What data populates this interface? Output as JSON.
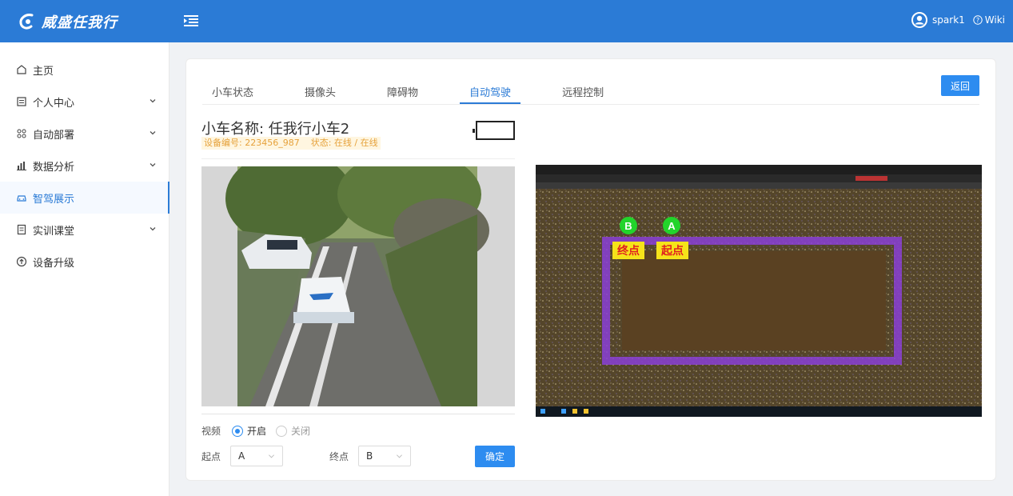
{
  "app": {
    "title": "威盛任我行",
    "user": "spark1",
    "wiki": "Wiki",
    "brand_color": "#2b7bd6"
  },
  "sidebar": {
    "items": [
      {
        "label": "主页",
        "icon": "home-icon",
        "expandable": false,
        "active": false
      },
      {
        "label": "个人中心",
        "icon": "profile-icon",
        "expandable": true,
        "active": false
      },
      {
        "label": "自动部署",
        "icon": "grid-icon",
        "expandable": true,
        "active": false
      },
      {
        "label": "数据分析",
        "icon": "bar-chart-icon",
        "expandable": true,
        "active": false
      },
      {
        "label": "智驾展示",
        "icon": "car-icon",
        "expandable": false,
        "active": true
      },
      {
        "label": "实训课堂",
        "icon": "book-icon",
        "expandable": true,
        "active": false
      },
      {
        "label": "设备升级",
        "icon": "upgrade-icon",
        "expandable": false,
        "active": false
      }
    ]
  },
  "tabs": [
    {
      "label": "小车状态",
      "active": false
    },
    {
      "label": "摄像头",
      "active": false
    },
    {
      "label": "障碍物",
      "active": false
    },
    {
      "label": "自动驾驶",
      "active": true
    },
    {
      "label": "远程控制",
      "active": false
    }
  ],
  "back_button": "返回",
  "car": {
    "name": "小车名称: 任我行小车2",
    "device_id": "设备编号: 223456_987",
    "status": "状态: 在线 / 在线",
    "battery_level": 0
  },
  "video_control": {
    "label": "视频",
    "on_label": "开启",
    "off_label": "关闭",
    "selected": "on"
  },
  "route": {
    "start_label": "起点",
    "start_value": "A",
    "end_label": "终点",
    "end_value": "B",
    "confirm": "确定"
  },
  "map": {
    "marker_b": {
      "letter": "B",
      "label": "终点"
    },
    "marker_a": {
      "letter": "A",
      "label": "起点"
    },
    "marker_color": "#22d42b",
    "label_bg": "#f5e31a",
    "label_color": "#e02020"
  }
}
